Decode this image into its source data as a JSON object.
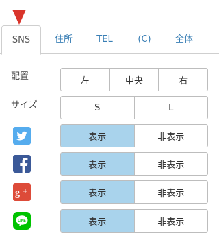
{
  "tabs": [
    {
      "label": "SNS",
      "active": true
    },
    {
      "label": "住所",
      "active": false
    },
    {
      "label": "TEL",
      "active": false
    },
    {
      "label": "(C)",
      "active": false
    },
    {
      "label": "全体",
      "active": false
    }
  ],
  "placement": {
    "label": "配置",
    "options": [
      "左",
      "中央",
      "右"
    ]
  },
  "size": {
    "label": "サイズ",
    "options": [
      "S",
      "L"
    ]
  },
  "sns_rows": [
    {
      "icon": "twitter-icon",
      "show": "表示",
      "hide": "非表示",
      "selected": "show",
      "color": "#55acee"
    },
    {
      "icon": "facebook-icon",
      "show": "表示",
      "hide": "非表示",
      "selected": "show",
      "color": "#3b5998"
    },
    {
      "icon": "google-plus-icon",
      "show": "表示",
      "hide": "非表示",
      "selected": "show",
      "color": "#dd4b39"
    },
    {
      "icon": "line-icon",
      "show": "表示",
      "hide": "非表示",
      "selected": "show",
      "color": "#00c300"
    }
  ],
  "colors": {
    "selected": "#a9d3ec",
    "tab_text": "#3a7fb5",
    "marker": "#d9342b"
  }
}
